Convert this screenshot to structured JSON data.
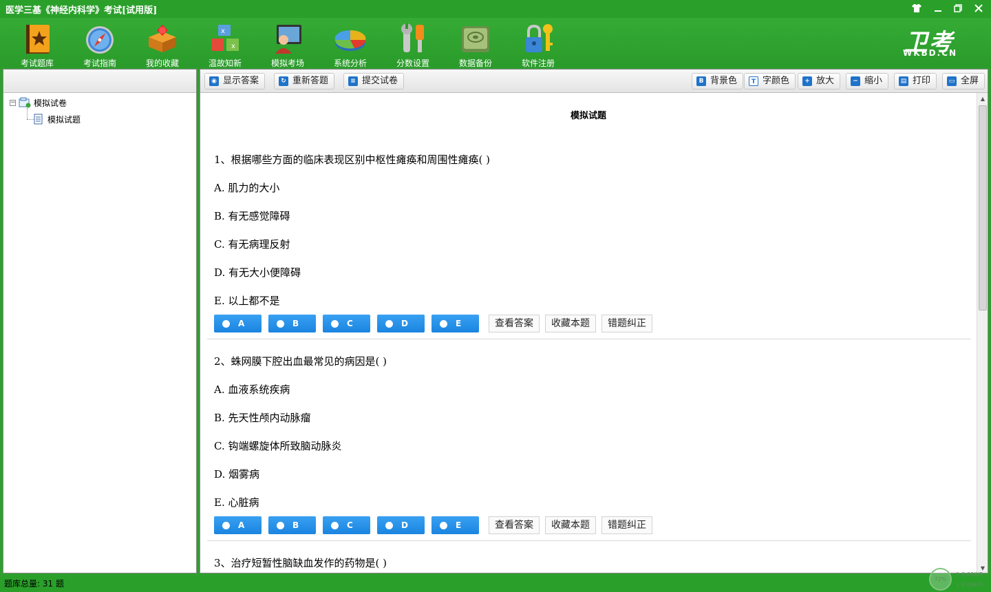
{
  "window": {
    "title": "医学三基《神经内科学》考试[试用版]",
    "controls": [
      "skin",
      "minimize",
      "restore",
      "close"
    ]
  },
  "toolbar": {
    "items": [
      {
        "label": "考试题库",
        "icon": "book-star-icon"
      },
      {
        "label": "考试指南",
        "icon": "compass-icon"
      },
      {
        "label": "我的收藏",
        "icon": "gift-box-icon"
      },
      {
        "label": "温故知新",
        "icon": "cubes-icon"
      },
      {
        "label": "模拟考场",
        "icon": "monitor-user-icon"
      },
      {
        "label": "系统分析",
        "icon": "pie-chart-icon"
      },
      {
        "label": "分数设置",
        "icon": "wrench-icon"
      },
      {
        "label": "数据备份",
        "icon": "disk-icon"
      },
      {
        "label": "软件注册",
        "icon": "lock-key-icon"
      }
    ]
  },
  "logo": {
    "big": "卫考",
    "small": "WKBD.CN"
  },
  "tree": {
    "root": "模拟试卷",
    "child": "模拟试题"
  },
  "actions": {
    "show_answer": "显示答案",
    "redo": "重新答题",
    "submit": "提交试卷",
    "bg_color": "背景色",
    "font_color": "字颜色",
    "zoom_in": "放大",
    "zoom_out": "缩小",
    "print": "打印",
    "fullscreen": "全屏"
  },
  "page_heading": "模拟试题",
  "answer_buttons": [
    "A",
    "B",
    "C",
    "D",
    "E"
  ],
  "question_actions": {
    "view": "查看答案",
    "favorite": "收藏本题",
    "correct": "错题纠正"
  },
  "questions": [
    {
      "title": "1、根据哪些方面的临床表现区别中枢性瘫痪和周围性瘫痪(   )",
      "options": [
        "A.  肌力的大小",
        "B.  有无感觉障碍",
        "C.  有无病理反射",
        "D.  有无大小便障碍",
        "E.  以上都不是"
      ]
    },
    {
      "title": "2、蛛网膜下腔出血最常见的病因是(   )",
      "options": [
        "A.  血液系统疾病",
        "B.  先天性颅内动脉瘤",
        "C.  钩端螺旋体所致脑动脉炎",
        "D.  烟雾病",
        "E.  心脏病"
      ]
    },
    {
      "title": "3、治疗短暂性脑缺血发作的药物是(   )",
      "options": []
    }
  ],
  "status": {
    "text": "题库总量: 31 题",
    "cpu": "72%",
    "up": "↑ 0.09K/S",
    "down": "↓ 0.09K/S"
  },
  "colors": {
    "accent_green": "#2aa02a",
    "answer_blue": "#1a84e0"
  }
}
